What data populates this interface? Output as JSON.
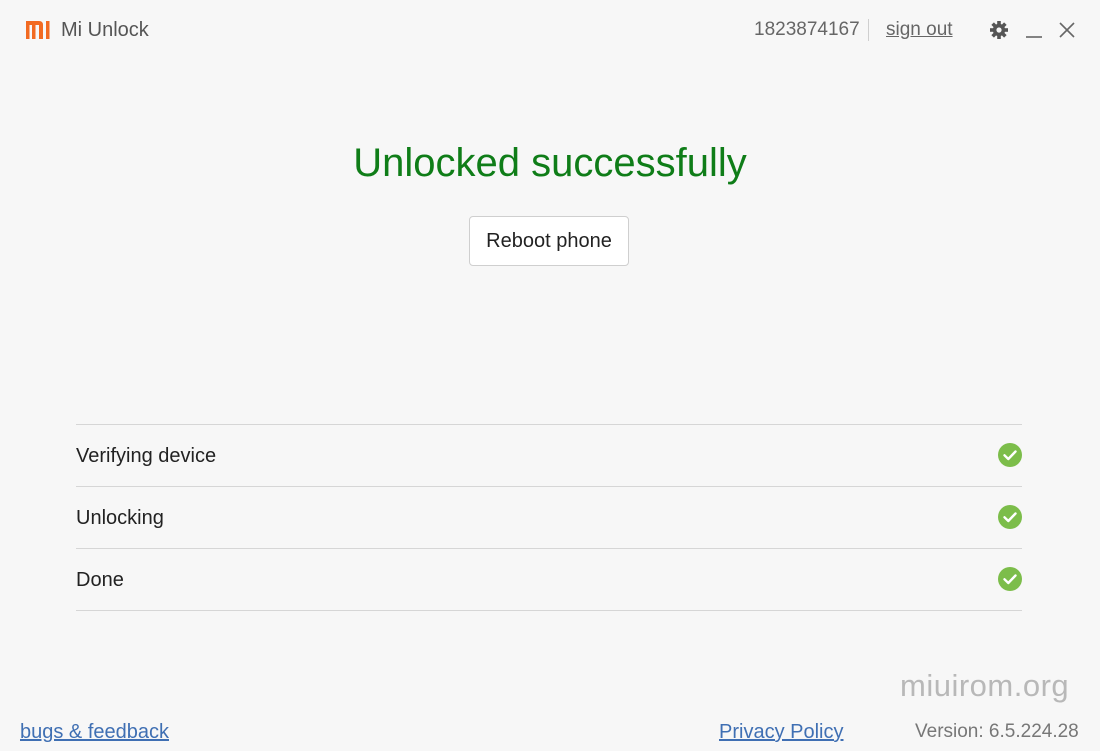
{
  "window": {
    "title": "Mi Unlock",
    "account_id": "1823874167",
    "sign_out": "sign out",
    "brand_color": "#f26a21"
  },
  "main": {
    "headline": "Unlocked successfully",
    "headline_color": "#0f7d18",
    "reboot_label": "Reboot phone"
  },
  "steps": [
    {
      "label": "Verifying device",
      "status": "done",
      "icon": "check-circle-icon"
    },
    {
      "label": "Unlocking",
      "status": "done",
      "icon": "check-circle-icon"
    },
    {
      "label": "Done",
      "status": "done",
      "icon": "check-circle-icon"
    }
  ],
  "check_color": "#7cbd4a",
  "footer": {
    "bugs_feedback": "bugs & feedback",
    "privacy_policy": "Privacy Policy",
    "version": "Version: 6.5.224.28",
    "watermark": "miuirom.org"
  }
}
